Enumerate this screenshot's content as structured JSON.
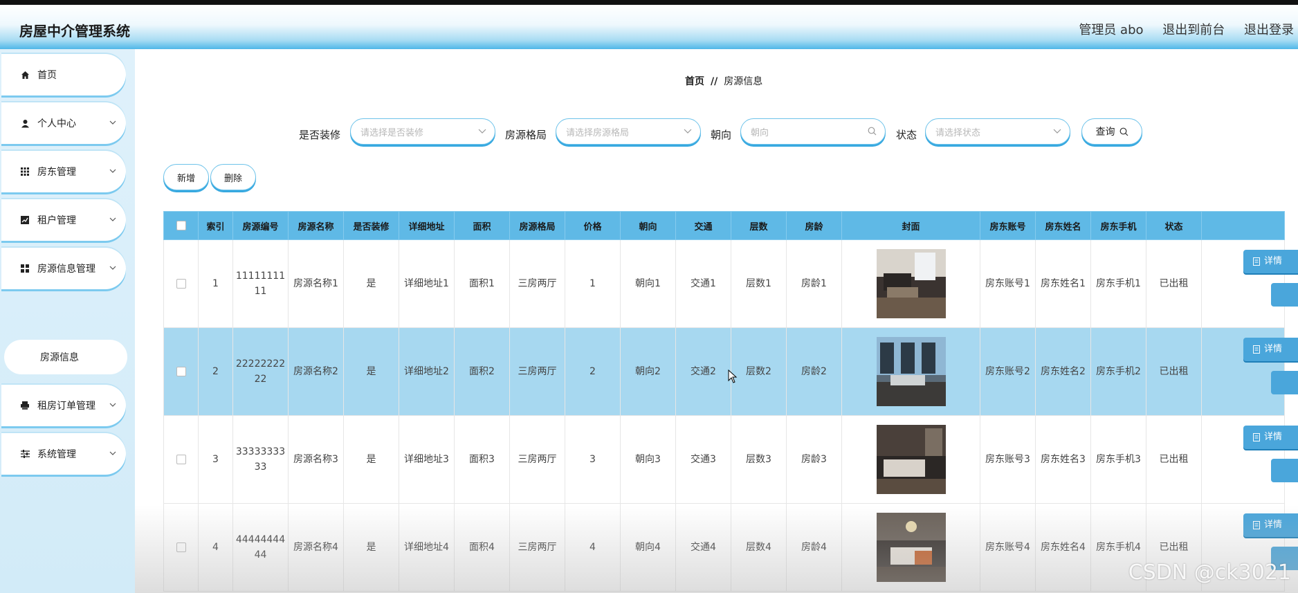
{
  "header": {
    "app_title": "房屋中介管理系统",
    "user_label": "管理员 abo",
    "back_to_front": "退出到前台",
    "logout": "退出登录"
  },
  "sidebar": {
    "items": [
      {
        "label": "首页",
        "icon": "home-icon"
      },
      {
        "label": "个人中心",
        "icon": "user-icon"
      },
      {
        "label": "房东管理",
        "icon": "grid-icon"
      },
      {
        "label": "租户管理",
        "icon": "chart-icon"
      },
      {
        "label": "房源信息管理",
        "icon": "apps-icon"
      },
      {
        "label": "房源信息",
        "icon": ""
      },
      {
        "label": "租房订单管理",
        "icon": "printer-icon"
      },
      {
        "label": "系统管理",
        "icon": "sliders-icon"
      }
    ]
  },
  "breadcrumb": {
    "home": "首页",
    "separator": "//",
    "current": "房源信息"
  },
  "filters": {
    "decorated_label": "是否装修",
    "decorated_placeholder": "请选择是否装修",
    "layout_label": "房源格局",
    "layout_placeholder": "请选择房源格局",
    "orientation_label": "朝向",
    "orientation_placeholder": "朝向",
    "status_label": "状态",
    "status_placeholder": "请选择状态",
    "query_button": "查询"
  },
  "actions": {
    "add": "新增",
    "delete": "删除",
    "detail": "详情"
  },
  "table": {
    "columns": [
      "索引",
      "房源编号",
      "房源名称",
      "是否装修",
      "详细地址",
      "面积",
      "房源格局",
      "价格",
      "朝向",
      "交通",
      "层数",
      "房龄",
      "封面",
      "房东账号",
      "房东姓名",
      "房东手机",
      "状态"
    ],
    "rows": [
      {
        "index": "1",
        "code": "1111111111",
        "name": "房源名称1",
        "decorated": "是",
        "address": "详细地址1",
        "area": "面积1",
        "layout": "三房两厅",
        "price": "1",
        "orientation": "朝向1",
        "traffic": "交通1",
        "floors": "层数1",
        "age": "房龄1",
        "landlord_account": "房东账号1",
        "landlord_name": "房东姓名1",
        "landlord_phone": "房东手机1",
        "status": "已出租"
      },
      {
        "index": "2",
        "code": "2222222222",
        "name": "房源名称2",
        "decorated": "是",
        "address": "详细地址2",
        "area": "面积2",
        "layout": "三房两厅",
        "price": "2",
        "orientation": "朝向2",
        "traffic": "交通2",
        "floors": "层数2",
        "age": "房龄2",
        "landlord_account": "房东账号2",
        "landlord_name": "房东姓名2",
        "landlord_phone": "房东手机2",
        "status": "已出租"
      },
      {
        "index": "3",
        "code": "3333333333",
        "name": "房源名称3",
        "decorated": "是",
        "address": "详细地址3",
        "area": "面积3",
        "layout": "三房两厅",
        "price": "3",
        "orientation": "朝向3",
        "traffic": "交通3",
        "floors": "层数3",
        "age": "房龄3",
        "landlord_account": "房东账号3",
        "landlord_name": "房东姓名3",
        "landlord_phone": "房东手机3",
        "status": "已出租"
      },
      {
        "index": "4",
        "code": "4444444444",
        "name": "房源名称4",
        "decorated": "是",
        "address": "详细地址4",
        "area": "面积4",
        "layout": "三房两厅",
        "price": "4",
        "orientation": "朝向4",
        "traffic": "交通4",
        "floors": "层数4",
        "age": "房龄4",
        "landlord_account": "房东账号4",
        "landlord_name": "房东姓名4",
        "landlord_phone": "房东手机4",
        "status": "已出租"
      }
    ]
  },
  "watermark": "CSDN @ck3021",
  "colors": {
    "accent": "#5fb9e6",
    "selected_row": "#a7d8f0",
    "button_blue": "#4aa6db"
  }
}
